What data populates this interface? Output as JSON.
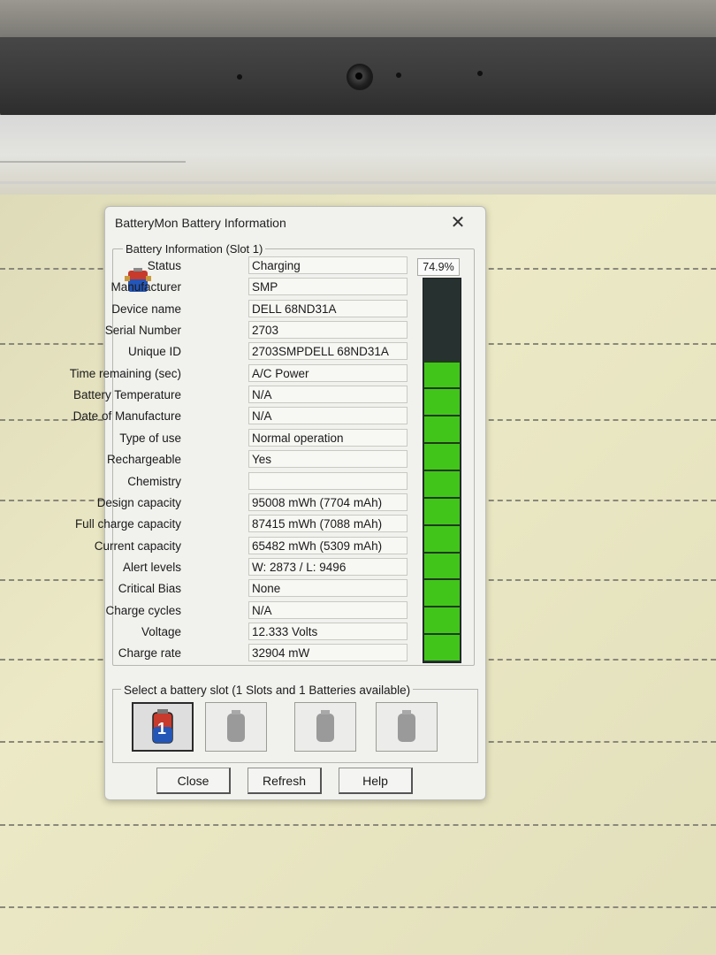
{
  "window": {
    "title": "BatteryMon Battery Information",
    "close_icon": "close-icon"
  },
  "info": {
    "group_label": "Battery Information (Slot 1)",
    "fields": [
      {
        "label": "Status",
        "value": "Charging"
      },
      {
        "label": "Manufacturer",
        "value": "SMP"
      },
      {
        "label": "Device name",
        "value": "DELL 68ND31A"
      },
      {
        "label": "Serial Number",
        "value": "2703"
      },
      {
        "label": "Unique ID",
        "value": "2703SMPDELL 68ND31A"
      },
      {
        "label": "Time remaining (sec)",
        "value": "A/C Power"
      },
      {
        "label": "Battery Temperature",
        "value": "N/A"
      },
      {
        "label": "Date of Manufacture",
        "value": "N/A"
      },
      {
        "label": "Type of use",
        "value": "Normal operation"
      },
      {
        "label": "Rechargeable",
        "value": "Yes"
      },
      {
        "label": "Chemistry",
        "value": ""
      },
      {
        "label": "Design capacity",
        "value": "95008 mWh (7704 mAh)"
      },
      {
        "label": "Full charge capacity",
        "value": "87415 mWh (7088 mAh)"
      },
      {
        "label": "Current capacity",
        "value": "65482 mWh (5309 mAh)"
      },
      {
        "label": "Alert levels",
        "value": "W: 2873 / L: 9496"
      },
      {
        "label": "Critical Bias",
        "value": "None"
      },
      {
        "label": "Charge cycles",
        "value": "N/A"
      },
      {
        "label": "Voltage",
        "value": "12.333 Volts"
      },
      {
        "label": "Charge rate",
        "value": "32904 mW"
      }
    ]
  },
  "meter": {
    "percent_text": "74.9%",
    "level": 0.749,
    "segments_total": 14,
    "segments_lit": 11,
    "lit_color": "#42c51b",
    "empty_color": "#263130"
  },
  "slots": {
    "label": "Select a battery slot (1 Slots and 1 Batteries available)",
    "items": [
      {
        "name": "slot-1",
        "active": true,
        "icon": "battery-slot-1-icon"
      },
      {
        "name": "slot-2",
        "active": false,
        "icon": "battery-empty-icon"
      },
      {
        "name": "slot-3",
        "active": false,
        "icon": "battery-empty-icon"
      },
      {
        "name": "slot-4",
        "active": false,
        "icon": "battery-empty-icon"
      }
    ]
  },
  "buttons": {
    "close": "Close",
    "refresh": "Refresh",
    "help": "Help"
  }
}
